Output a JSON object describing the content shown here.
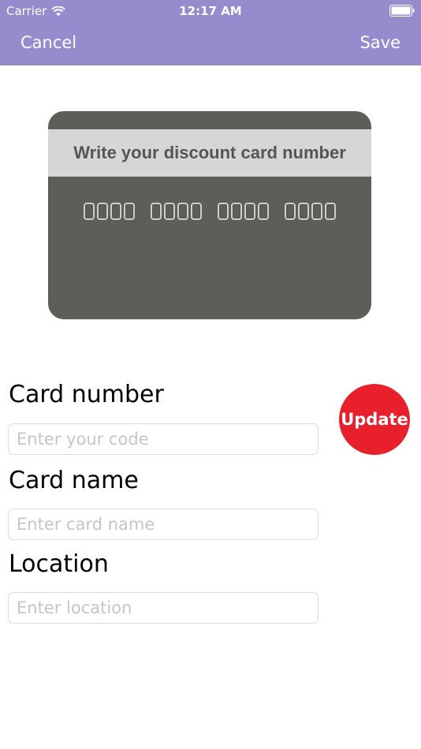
{
  "status_bar": {
    "carrier": "Carrier",
    "time": "12:17 AM",
    "icons": [
      "wifi-icon",
      "battery-icon"
    ]
  },
  "nav": {
    "cancel_label": "Cancel",
    "save_label": "Save"
  },
  "card_image": {
    "band_text": "Write your discount card number",
    "digit_groups": 4
  },
  "form": {
    "card_number": {
      "label": "Card number",
      "placeholder": "Enter your code",
      "value": ""
    },
    "card_name": {
      "label": "Card name",
      "placeholder": "Enter card name",
      "value": ""
    },
    "location": {
      "label": "Location",
      "placeholder": "Enter location",
      "value": ""
    }
  },
  "update_button": {
    "label": "Update"
  },
  "colors": {
    "nav_bar": "#978bce",
    "card_body": "#5e5e58",
    "card_band": "#d6d6d6",
    "update_button": "#e8202b"
  }
}
